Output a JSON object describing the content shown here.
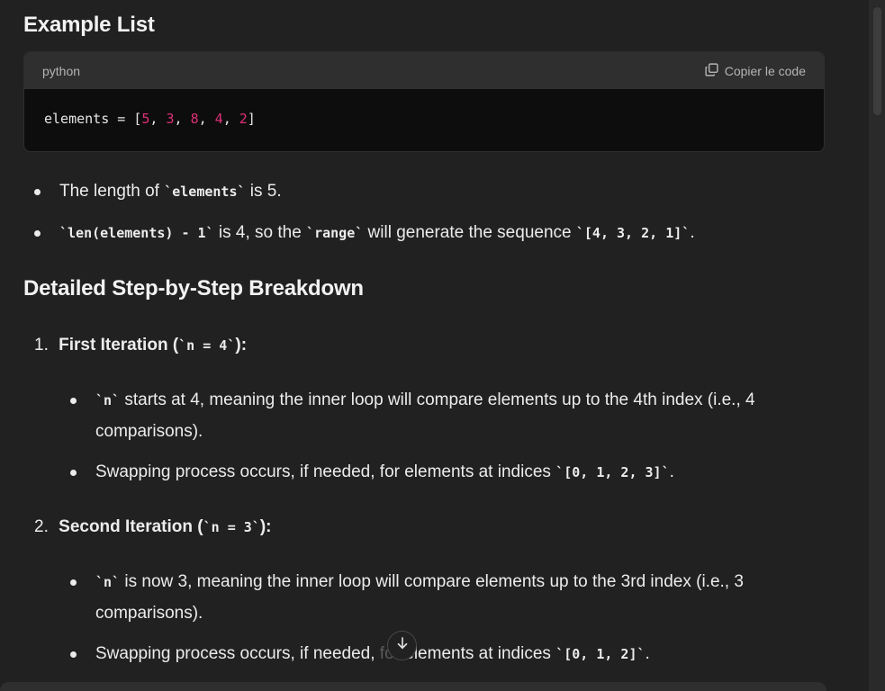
{
  "headings": {
    "example": "Example List",
    "breakdown": "Detailed Step-by-Step Breakdown"
  },
  "code_block": {
    "language": "python",
    "copy_label": "Copier le code",
    "code": {
      "var": "elements",
      "op": " = [",
      "n1": "5",
      "n2": "3",
      "n3": "8",
      "n4": "4",
      "n5": "2",
      "sep": ", ",
      "close": "]"
    }
  },
  "bullets_top": [
    {
      "pre": "The length of ",
      "code": "`elements`",
      "post": " is 5."
    },
    {
      "pre": "",
      "code": "`len(elements) - 1`",
      "mid": " is 4, so the ",
      "code2": "`range`",
      "post": " will generate the sequence ",
      "code3": "`[4, 3, 2, 1]`",
      "end": "."
    }
  ],
  "steps": [
    {
      "number": "1.",
      "title": "First Iteration (",
      "code": "`n = 4`",
      "title_end": "):",
      "items": [
        {
          "code": "`n`",
          "line1": " starts at 4, meaning the inner loop will compare elements up to the 4th index (i.e., 4",
          "line2": "comparisons)."
        },
        {
          "pre": "Swapping process occurs, if needed, for elements at indices ",
          "code": "`[0, 1, 2, 3]`",
          "post": "."
        }
      ]
    },
    {
      "number": "2.",
      "title": "Second Iteration (",
      "code": "`n = 3`",
      "title_end": "):",
      "items": [
        {
          "code": "`n`",
          "line1": " is now 3, meaning the inner loop will compare elements up to the 3rd index (i.e., 3",
          "line2": "comparisons)."
        },
        {
          "pre": "Swapping process occurs, if needed, ",
          "hidden": "for",
          "post_pre": " elements at indices ",
          "code": "`[0, 1, 2]`",
          "post": "."
        }
      ]
    }
  ],
  "colors": {
    "background": "#212121",
    "code_bg": "#0d0d0d",
    "code_header": "#2f2f2f",
    "number_literal": "#df3079"
  },
  "icons": {
    "copy": "copy-icon",
    "scroll_down": "arrow-down-icon"
  }
}
